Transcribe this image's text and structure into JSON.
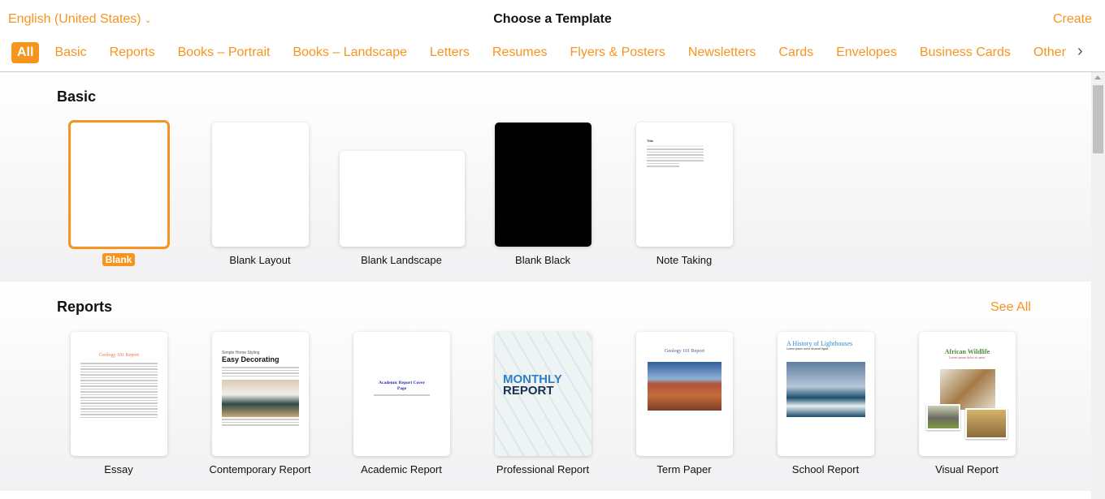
{
  "header": {
    "language": "English (United States)",
    "title": "Choose a Template",
    "create_label": "Create"
  },
  "tabs": [
    "All",
    "Basic",
    "Reports",
    "Books – Portrait",
    "Books – Landscape",
    "Letters",
    "Resumes",
    "Flyers & Posters",
    "Newsletters",
    "Cards",
    "Envelopes",
    "Business Cards",
    "Other"
  ],
  "active_tab": "All",
  "accent_color": "#f7941d",
  "sections": {
    "basic": {
      "title": "Basic",
      "items": [
        "Blank",
        "Blank Layout",
        "Blank Landscape",
        "Blank Black",
        "Note Taking"
      ],
      "selected": "Blank"
    },
    "reports": {
      "title": "Reports",
      "see_all": "See All",
      "items": [
        "Essay",
        "Contemporary Report",
        "Academic Report",
        "Professional Report",
        "Term Paper",
        "School Report",
        "Visual Report"
      ]
    }
  },
  "thumbs": {
    "note_title": "Title",
    "essay_title": "Geology 101 Report",
    "contemporary_kicker": "Simple Home Styling",
    "contemporary_title": "Easy Decorating",
    "academic_title": "Academic Report Cover Page",
    "professional_title1": "MONTHLY",
    "professional_title2": "REPORT",
    "term_title": "Geology 101 Report",
    "school_title": "A History of Lighthouses",
    "school_sub": "Lorem ipsum dolor sit amet ligula",
    "visual_title": "African Wildlife",
    "visual_sub": "Lorem ipsum dolor sit amet."
  }
}
